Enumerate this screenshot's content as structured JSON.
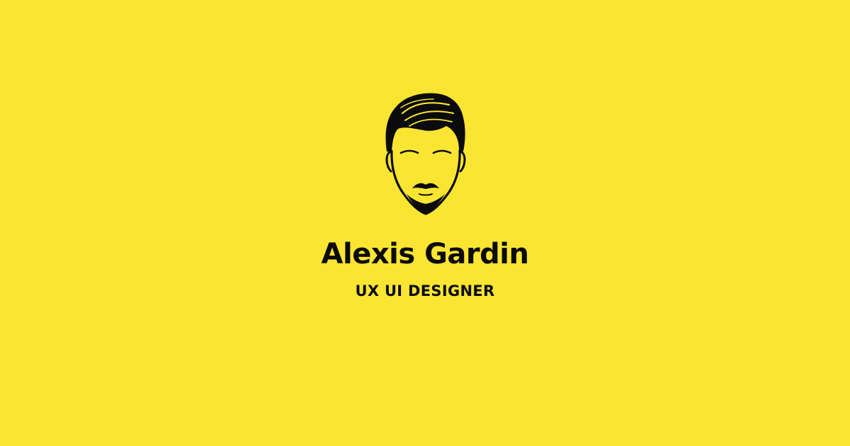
{
  "colors": {
    "background": "#FAE532",
    "ink": "#0B0B0B"
  },
  "logo": {
    "icon": "man-face-portrait-icon"
  },
  "profile": {
    "name": "Alexis Gardin",
    "title": "UX UI DESIGNER"
  }
}
